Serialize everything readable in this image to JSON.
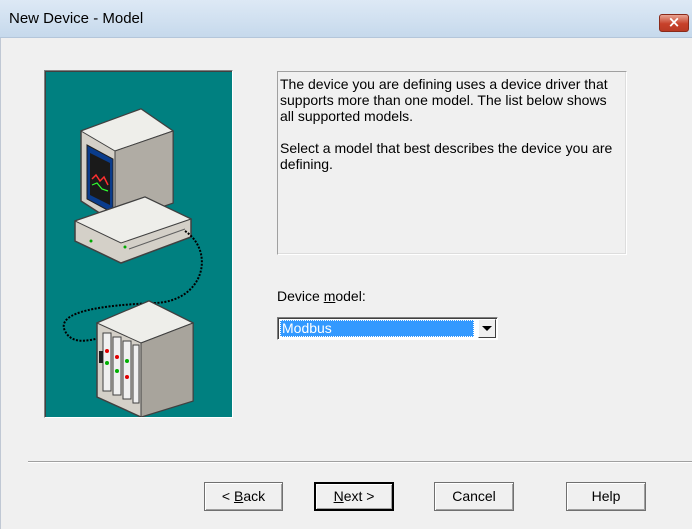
{
  "window": {
    "title": "New Device - Model",
    "close_glyph": "×"
  },
  "description": {
    "paragraph1": "The device you are defining uses a device driver that supports more than one model.  The list below shows all supported models.",
    "paragraph2": "Select  a model that best describes the device you are defining."
  },
  "model": {
    "label_pre": "Device ",
    "label_mnemonic": "m",
    "label_post": "odel:",
    "selected_value": "Modbus"
  },
  "buttons": {
    "back_prefix": "< ",
    "back_mnemonic": "B",
    "back_rest": "ack",
    "next_mnemonic": "N",
    "next_rest": "ext >",
    "cancel": "Cancel",
    "help": "Help"
  },
  "icons": {
    "illustration": "computer-to-device-icon",
    "dropdown": "chevron-down-icon",
    "close": "close-icon"
  },
  "colors": {
    "illustration_bg": "#008080",
    "selection": "#3399ff",
    "close_button": "#c7412a"
  }
}
